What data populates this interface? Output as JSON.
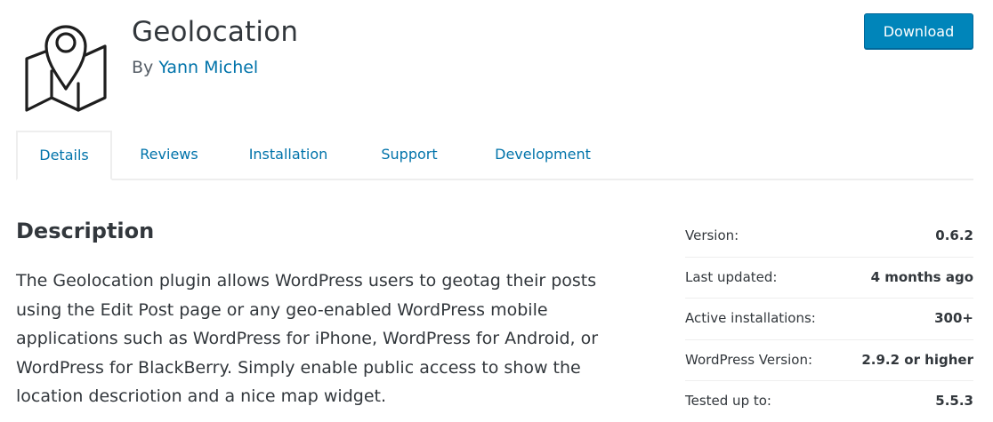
{
  "plugin": {
    "title": "Geolocation",
    "by_prefix": "By ",
    "author": "Yann Michel",
    "icon": "map-pin-icon"
  },
  "header": {
    "download_label": "Download",
    "accent_color": "#0085ba"
  },
  "tabs": [
    {
      "label": "Details",
      "active": true
    },
    {
      "label": "Reviews",
      "active": false
    },
    {
      "label": "Installation",
      "active": false
    },
    {
      "label": "Support",
      "active": false
    },
    {
      "label": "Development",
      "active": false
    }
  ],
  "description": {
    "heading": "Description",
    "text": "The Geolocation plugin allows WordPress users to geotag their posts using the Edit Post page or any geo-enabled WordPress mobile applications such as WordPress for iPhone, WordPress for Android, or WordPress for BlackBerry. Simply enable public access to show the location descriotion and a nice map widget."
  },
  "meta": [
    {
      "label": "Version:",
      "value": "0.6.2"
    },
    {
      "label": "Last updated:",
      "value": "4 months ago"
    },
    {
      "label": "Active installations:",
      "value": "300+"
    },
    {
      "label": "WordPress Version:",
      "value": "2.9.2 or higher"
    },
    {
      "label": "Tested up to:",
      "value": "5.5.3"
    }
  ]
}
